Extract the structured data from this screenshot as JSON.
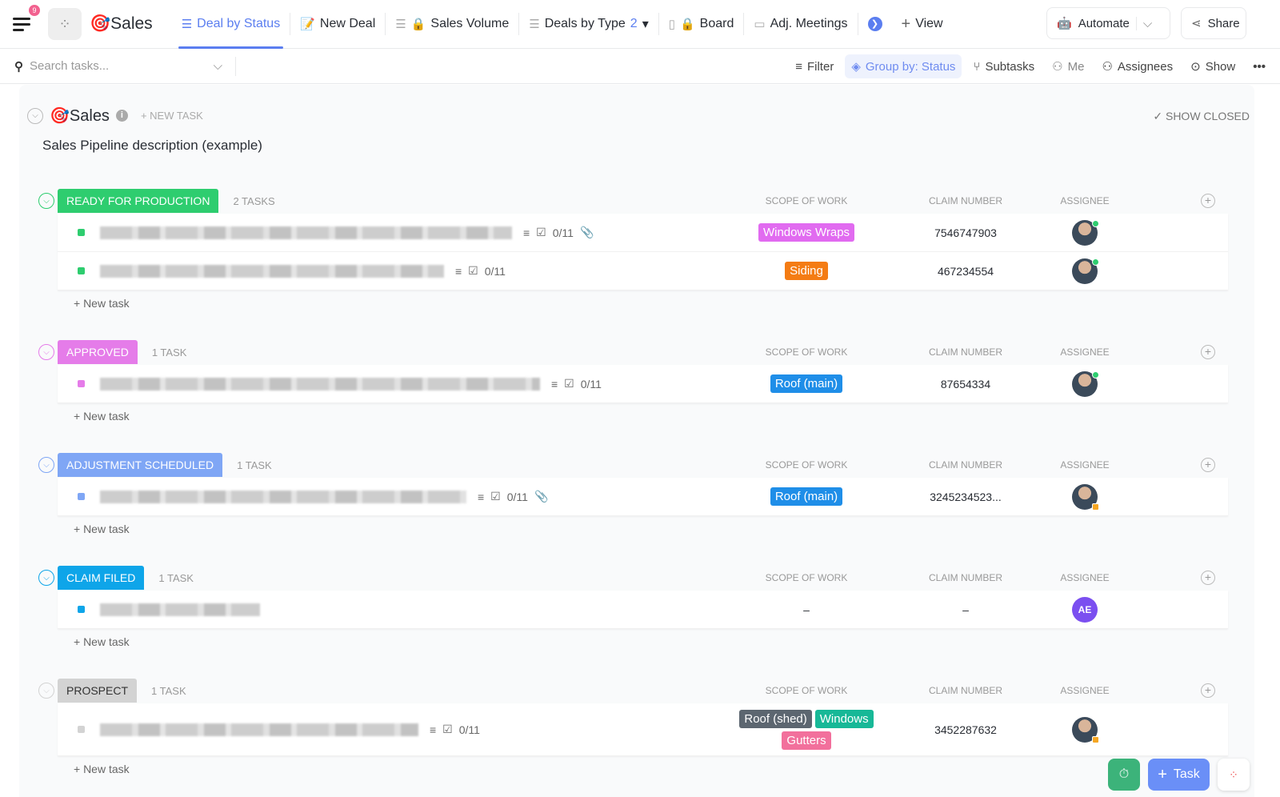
{
  "app": {
    "title": "Sales",
    "notifications": "9"
  },
  "tabs": [
    {
      "label": "Deal by Status",
      "icon": "list-icon",
      "active": true
    },
    {
      "label": "New Deal",
      "icon": "form-icon"
    },
    {
      "label": "Sales Volume",
      "icon": "list-icon",
      "locked": true
    },
    {
      "label": "Deals by Type",
      "icon": "list-icon",
      "count": "2"
    },
    {
      "label": "Board",
      "icon": "board-icon",
      "locked": true
    },
    {
      "label": "Adj. Meetings",
      "icon": "calendar-icon"
    }
  ],
  "top_actions": {
    "view": "View",
    "automate": "Automate",
    "share": "Share"
  },
  "toolbar": {
    "search_placeholder": "Search tasks...",
    "filter": "Filter",
    "group_by": "Group by: Status",
    "subtasks": "Subtasks",
    "me": "Me",
    "assignees": "Assignees",
    "show": "Show"
  },
  "list": {
    "title": "Sales",
    "new_task": "+ NEW TASK",
    "show_closed": "SHOW CLOSED",
    "description": "Sales Pipeline description (example)"
  },
  "columns": [
    "SCOPE OF WORK",
    "CLAIM NUMBER",
    "ASSIGNEE"
  ],
  "new_task_label": "+ New task",
  "groups": [
    {
      "status": "READY FOR PRODUCTION",
      "color": "#2ecd6f",
      "count": "2 TASKS",
      "tasks": [
        {
          "name_width": 515,
          "subtasks": "0/11",
          "attachment": true,
          "scope": [
            {
              "label": "Windows Wraps",
              "color": "#e16bf0"
            }
          ],
          "claim": "7546747903",
          "assignee": "photo",
          "status": "online"
        },
        {
          "name_width": 430,
          "subtasks": "0/11",
          "scope": [
            {
              "label": "Siding",
              "color": "#f47c14"
            }
          ],
          "claim": "467234554",
          "assignee": "photo",
          "status": "online"
        }
      ]
    },
    {
      "status": "APPROVED",
      "color": "#e57ce9",
      "count": "1 TASK",
      "tasks": [
        {
          "name_width": 550,
          "subtasks": "0/11",
          "scope": [
            {
              "label": "Roof (main)",
              "color": "#1f8ee8"
            }
          ],
          "claim": "87654334",
          "assignee": "photo",
          "status": "online"
        }
      ]
    },
    {
      "status": "ADJUSTMENT SCHEDULED",
      "color": "#7fa6f5",
      "count": "1 TASK",
      "tasks": [
        {
          "name_width": 458,
          "subtasks": "0/11",
          "attachment": true,
          "scope": [
            {
              "label": "Roof (main)",
              "color": "#1f8ee8"
            }
          ],
          "claim": "3245234523...",
          "assignee": "photo",
          "status": "away"
        }
      ]
    },
    {
      "status": "CLAIM FILED",
      "color": "#0ea5e9",
      "count": "1 TASK",
      "tasks": [
        {
          "name_width": 200,
          "scope": [],
          "scope_empty": "–",
          "claim": "–",
          "assignee": "AE"
        }
      ]
    },
    {
      "status": "PROSPECT",
      "color": "#d3d3d3",
      "text_color": "#333",
      "count": "1 TASK",
      "tasks": [
        {
          "name_width": 398,
          "subtasks": "0/11",
          "scope": [
            {
              "label": "Roof (shed)",
              "color": "#5c6670"
            },
            {
              "label": "Windows",
              "color": "#17b897"
            },
            {
              "label": "Gutters",
              "color": "#f2709c"
            }
          ],
          "claim": "3452287632",
          "assignee": "photo",
          "status": "away",
          "tall": true
        }
      ]
    }
  ],
  "fab": {
    "task": "Task"
  }
}
